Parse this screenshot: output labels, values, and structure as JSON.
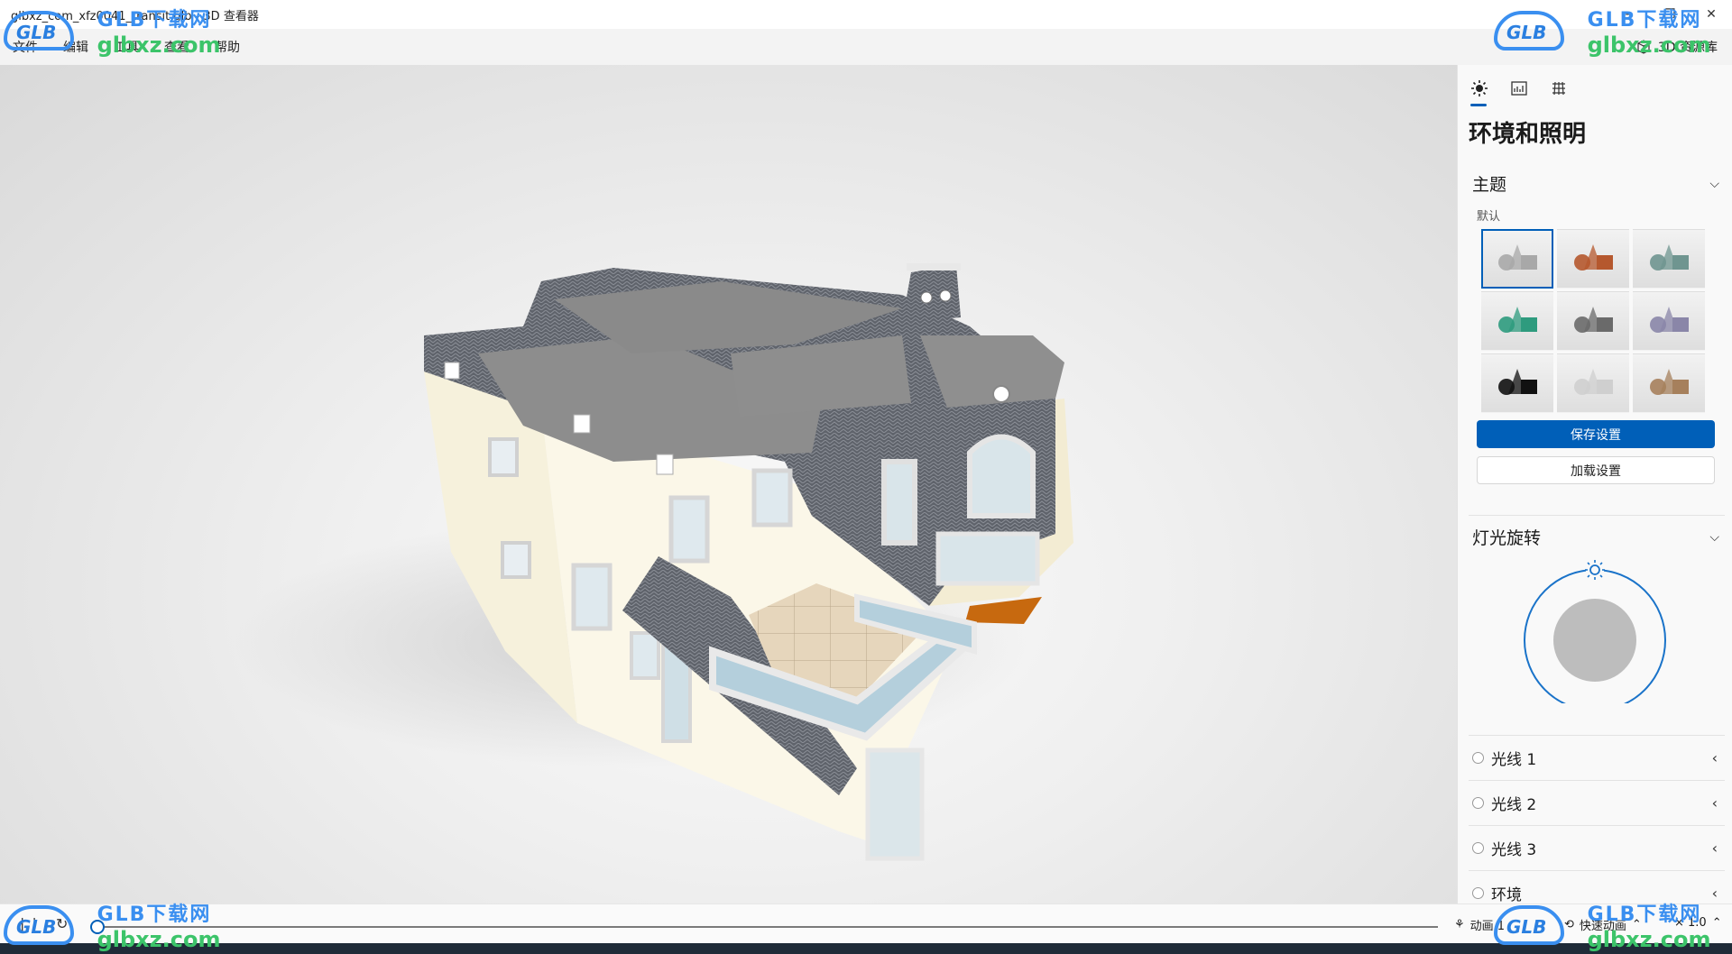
{
  "titlebar": {
    "title": "glbxz_com_xfz0041_transit.glb - 3D 查看器",
    "minimize_icon": "minimize-icon",
    "maximize_icon": "maximize-icon",
    "close_icon": "close-icon"
  },
  "menubar": {
    "items": [
      "文件",
      "编辑",
      "工具",
      "查看",
      "帮助"
    ],
    "library_label": "3D 资源库"
  },
  "panel": {
    "tabs": [
      "sun-icon",
      "stats-icon",
      "grid-icon"
    ],
    "title": "环境和照明",
    "theme_section": "主题",
    "theme_default_label": "默认",
    "themes": [
      {
        "name": "默认",
        "color": "#a8a8a8"
      },
      {
        "name": "theme-2",
        "color": "#b5582e"
      },
      {
        "name": "theme-3",
        "color": "#6f9590"
      },
      {
        "name": "theme-4",
        "color": "#2e9b7e"
      },
      {
        "name": "theme-5",
        "color": "#6a6a6a"
      },
      {
        "name": "theme-6",
        "color": "#8a86a8"
      },
      {
        "name": "theme-7",
        "color": "#111111"
      },
      {
        "name": "theme-8",
        "color": "#cfcfcf"
      },
      {
        "name": "theme-9",
        "color": "#a6805c"
      }
    ],
    "save_button": "保存设置",
    "load_button": "加载设置",
    "light_rotation_section": "灯光旋转",
    "lights": [
      "光线 1",
      "光线 2",
      "光线 3",
      "环境"
    ]
  },
  "timeline": {
    "animation_label": "动画 1",
    "quick_animation_label": "快速动画",
    "speed_label": "× 1.0"
  },
  "watermark": {
    "brand": "GLB下载网",
    "site": "glbxz.com",
    "logo": "GLB"
  },
  "colors": {
    "accent": "#005fb8",
    "roof": "#5f636b",
    "wall": "#f7f2e2",
    "base": "#c7690f"
  }
}
